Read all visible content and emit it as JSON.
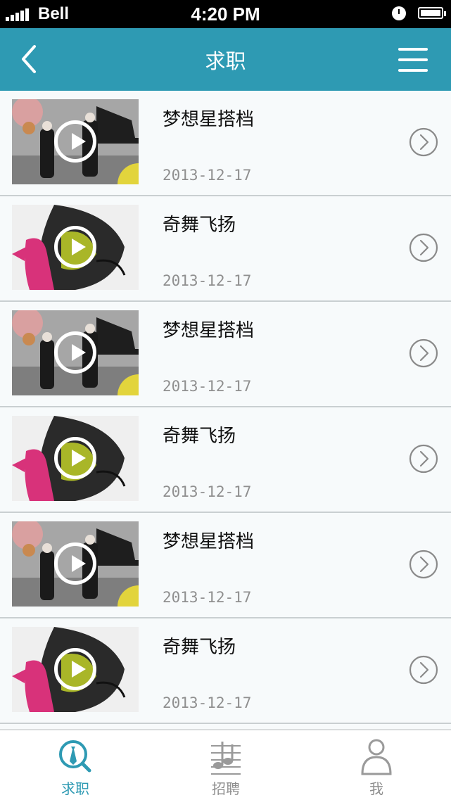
{
  "status_bar": {
    "carrier": "Bell",
    "time": "4:20 PM"
  },
  "nav": {
    "title": "求职",
    "back_icon": "chevron-left-icon",
    "menu_icon": "hamburger-menu-icon"
  },
  "list": [
    {
      "title": "梦想星搭档",
      "date": "2013-12-17",
      "thumb": "piano"
    },
    {
      "title": "奇舞飞扬",
      "date": "2013-12-17",
      "thumb": "dance"
    },
    {
      "title": "梦想星搭档",
      "date": "2013-12-17",
      "thumb": "piano"
    },
    {
      "title": "奇舞飞扬",
      "date": "2013-12-17",
      "thumb": "dance"
    },
    {
      "title": "梦想星搭档",
      "date": "2013-12-17",
      "thumb": "piano"
    },
    {
      "title": "奇舞飞扬",
      "date": "2013-12-17",
      "thumb": "dance"
    }
  ],
  "tabs": [
    {
      "label": "求职",
      "icon": "job-search-icon",
      "active": true
    },
    {
      "label": "招聘",
      "icon": "recruit-icon",
      "active": false
    },
    {
      "label": "我",
      "icon": "user-icon",
      "active": false
    }
  ],
  "colors": {
    "accent": "#2e9ab3",
    "status_bar": "#000000",
    "divider": "#c9cfd1"
  }
}
